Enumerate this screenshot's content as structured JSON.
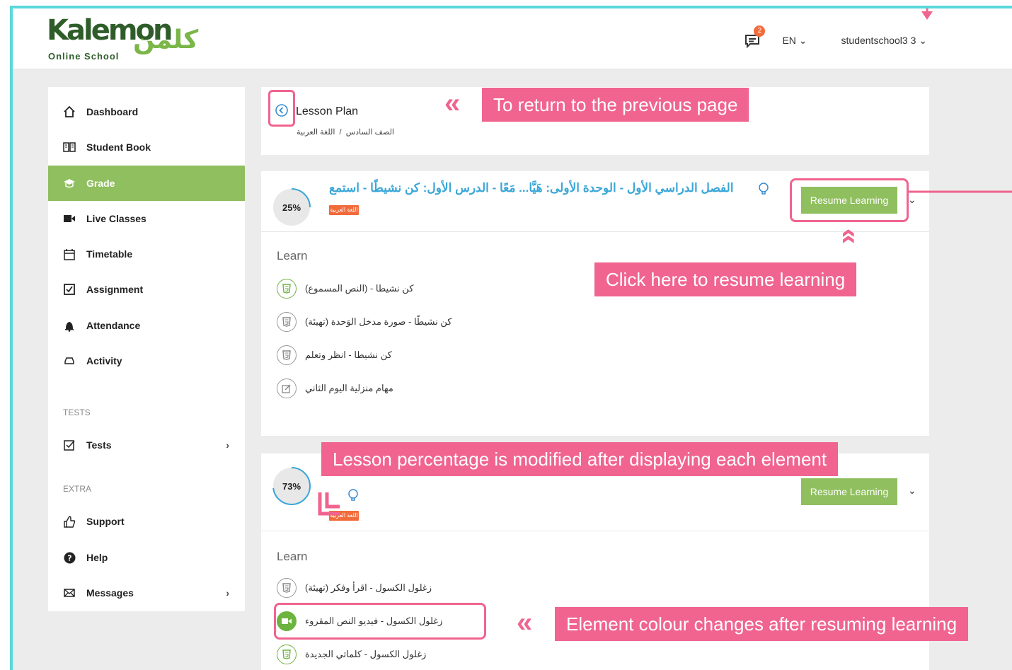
{
  "brand": {
    "name_latin": "Kalemon",
    "name_arabic": "كلمن",
    "tagline": "Online School"
  },
  "header": {
    "messages_badge": "2",
    "language": "EN",
    "username": "studentschool3 3"
  },
  "sidebar": {
    "items": [
      {
        "label": "Dashboard",
        "icon": "home-icon"
      },
      {
        "label": "Student Book",
        "icon": "book-icon"
      },
      {
        "label": "Grade",
        "icon": "graduation-cap-icon"
      },
      {
        "label": "Live Classes",
        "icon": "video-camera-icon"
      },
      {
        "label": "Timetable",
        "icon": "calendar-icon"
      },
      {
        "label": "Assignment",
        "icon": "checkbox-icon"
      },
      {
        "label": "Attendance",
        "icon": "bell-icon"
      },
      {
        "label": "Activity",
        "icon": "tray-icon"
      }
    ],
    "tests_heading": "TESTS",
    "tests_item": "Tests",
    "extra_heading": "EXTRA",
    "extra_items": [
      {
        "label": "Support",
        "icon": "thumbs-up-icon"
      },
      {
        "label": "Help",
        "icon": "help-icon"
      },
      {
        "label": "Messages",
        "icon": "envelope-icon"
      }
    ]
  },
  "lesson_plan": {
    "title": "Lesson Plan",
    "crumb_subject": "اللغة العربية",
    "crumb_sep": "/",
    "crumb_grade": "الصف السادس"
  },
  "lessons": [
    {
      "percent": "25%",
      "percent_value": 0.25,
      "title": "الفصل الدراسي الأول - الوحدة الأولى: هَيَّا... مَعًا - الدرس الأول: كن نشيطًا - استمع",
      "tag": "اللغة العربية",
      "resume_label": "Resume Learning",
      "learn_heading": "Learn",
      "elements": [
        "(كن نشيطا - (النص المسموع",
        "(كن نشيطًا - صورة مدخل الوَحدة (تهيئة",
        "كن نشيطا - انظر وتعلم",
        "مهام منزلية اليوم الثاني"
      ]
    },
    {
      "percent": "73%",
      "percent_value": 0.73,
      "tag": "اللغة العربية",
      "resume_label": "Resume Learning",
      "learn_heading": "Learn",
      "elements": [
        "(زغلول الكسول - اقرأ وفكر (تهيئة",
        "زغلول الكسول - فيديو النص المقروء",
        "زغلول الكسول - كلماتي الجديدة"
      ]
    }
  ],
  "annotations": {
    "back": "To return to the previous page",
    "resume": "Click here to resume learning",
    "percentage": "Lesson percentage is modified after displaying each element",
    "colour": "Element colour changes after resuming learning"
  },
  "colors": {
    "accent_green": "#8fbf5e",
    "annotation_pink": "#f0648f",
    "title_blue": "#3aa6d8",
    "tag_orange": "#f26b3a",
    "frame_cyan": "#5ad8dc"
  }
}
